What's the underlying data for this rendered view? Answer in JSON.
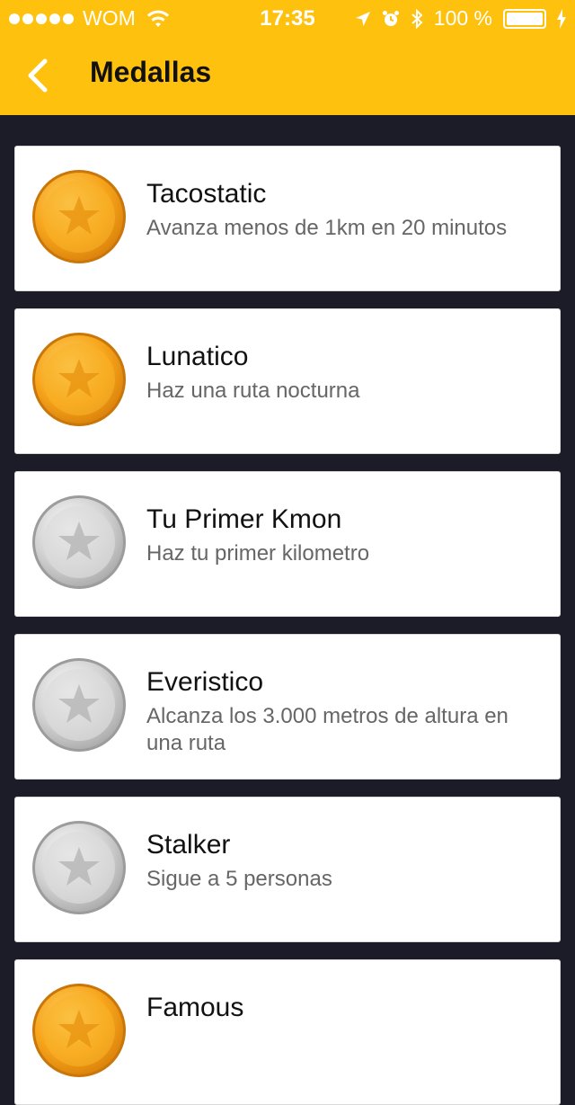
{
  "status": {
    "carrier": "WOM",
    "time": "17:35",
    "battery": "100 %"
  },
  "header": {
    "title": "Medallas"
  },
  "medals": [
    {
      "name": "Tacostatic",
      "description": "Avanza menos de 1km en 20 minutos",
      "earned": true
    },
    {
      "name": "Lunatico",
      "description": "Haz una ruta nocturna",
      "earned": true
    },
    {
      "name": "Tu Primer Kmon",
      "description": "Haz tu primer kilometro",
      "earned": false
    },
    {
      "name": "Everistico",
      "description": "Alcanza los 3.000 metros de altura en una ruta",
      "earned": false
    },
    {
      "name": "Stalker",
      "description": "Sigue a 5 personas",
      "earned": false
    },
    {
      "name": "Famous",
      "description": "",
      "earned": true
    }
  ],
  "colors": {
    "accent": "#fec10e",
    "background": "#1b1c27",
    "gold": "#f5a623",
    "silver": "#c8c8c8"
  }
}
